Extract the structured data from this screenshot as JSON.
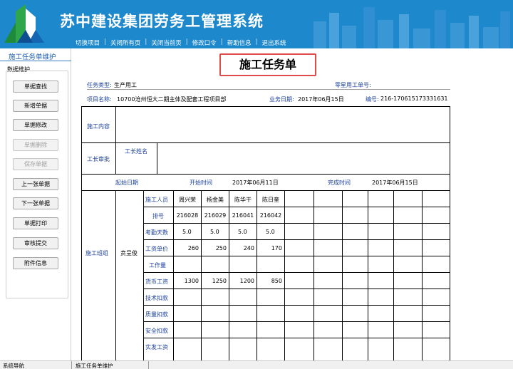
{
  "header": {
    "title": "苏中建设集团劳务工管理系统",
    "menu": [
      "切换项目",
      "关闭所有页",
      "关闭当前页",
      "修改口令",
      "帮助信息",
      "退出系统"
    ],
    "bg": "#1d88cc"
  },
  "left": {
    "tab": "施工任务单维护",
    "group_label": "数据维护",
    "buttons": [
      {
        "label": "单据查找",
        "disabled": false
      },
      {
        "label": "新增单据",
        "disabled": false
      },
      {
        "label": "单据修改",
        "disabled": false
      },
      {
        "label": "单据删除",
        "disabled": true
      },
      {
        "label": "保存单据",
        "disabled": true
      },
      {
        "label": "上一张单据",
        "disabled": false
      },
      {
        "label": "下一张单据",
        "disabled": false
      },
      {
        "label": "单据打印",
        "disabled": false
      },
      {
        "label": "审核提交",
        "disabled": false
      },
      {
        "label": "附件信息",
        "disabled": false
      }
    ]
  },
  "form": {
    "title": "施工任务单",
    "task_type_label": "任务类型:",
    "task_type": "生产用工",
    "odd_job_label": "零星用工单号:",
    "project_label": "项目名称:",
    "project": "10700沧州恒大二期主体及配套工程项目部",
    "biz_date_label": "业务日期:",
    "biz_date": "2017年06月15日",
    "code_label": "编号:",
    "code": "216-170615173331631",
    "content_label": "施工内容",
    "foreman_review_label": "工长审批",
    "foreman_name_label": "工长姓名",
    "start_end_label": "起始日期",
    "start_time_label": "开始时间",
    "start_time": "2017年06月11日",
    "end_time_label": "完成时间",
    "end_time": "2017年06月15日",
    "team_label": "施工班组",
    "team_leader": "贲呈俊",
    "row_labels": [
      "施工人员",
      "排号",
      "考勤天数",
      "工资单价",
      "工作量",
      "货币工资",
      "技术扣款",
      "质量扣款",
      "安全扣款",
      "实发工资"
    ],
    "workers": [
      {
        "name": "周兴荣",
        "no": "216028",
        "days": "5.0",
        "price": "260",
        "wage": "1300"
      },
      {
        "name": "杨金美",
        "no": "216029",
        "days": "5.0",
        "price": "250",
        "wage": "1250"
      },
      {
        "name": "陈华干",
        "no": "216041",
        "days": "5.0",
        "price": "240",
        "wage": "1200"
      },
      {
        "name": "陈日奎",
        "no": "216042",
        "days": "5.0",
        "price": "170",
        "wage": "850"
      }
    ]
  },
  "status": {
    "left": "系统导航",
    "right": "施工任务单维护"
  }
}
